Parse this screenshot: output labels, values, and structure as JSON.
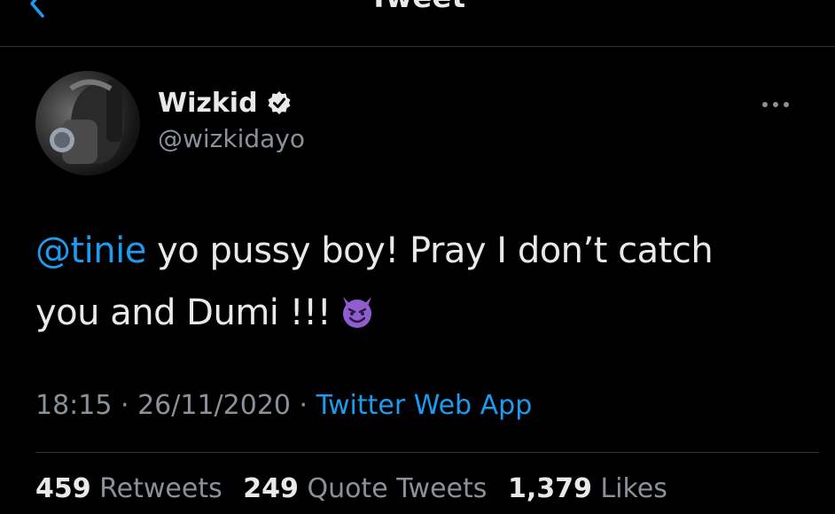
{
  "header": {
    "title": "Tweet",
    "back_icon": "chevron-left-icon"
  },
  "author": {
    "display_name": "Wizkid",
    "verified_icon": "verified-badge-icon",
    "handle": "@wizkidayo"
  },
  "more_icon": "more-horizontal-icon",
  "tweet": {
    "mention": "@tinie",
    "text_line_1_rest": " yo pussy boy! Pray I don’t catch",
    "text_line_2": "you and Dumi !!!",
    "emoji_icon": "smiling-imp-emoji-icon"
  },
  "meta": {
    "time": "18:15",
    "sep1": " · ",
    "date": "26/11/2020",
    "sep2": " · ",
    "source": "Twitter Web App"
  },
  "stats": {
    "retweets_count": "459",
    "retweets_label": "Retweets",
    "quotes_count": "249",
    "quotes_label": "Quote Tweets",
    "likes_count": "1,379",
    "likes_label": "Likes"
  },
  "colors": {
    "background": "#000000",
    "accent": "#1d9bf0",
    "primary_text": "#e7e9ea",
    "secondary_text": "#8b9198",
    "divider": "#2f3336"
  }
}
